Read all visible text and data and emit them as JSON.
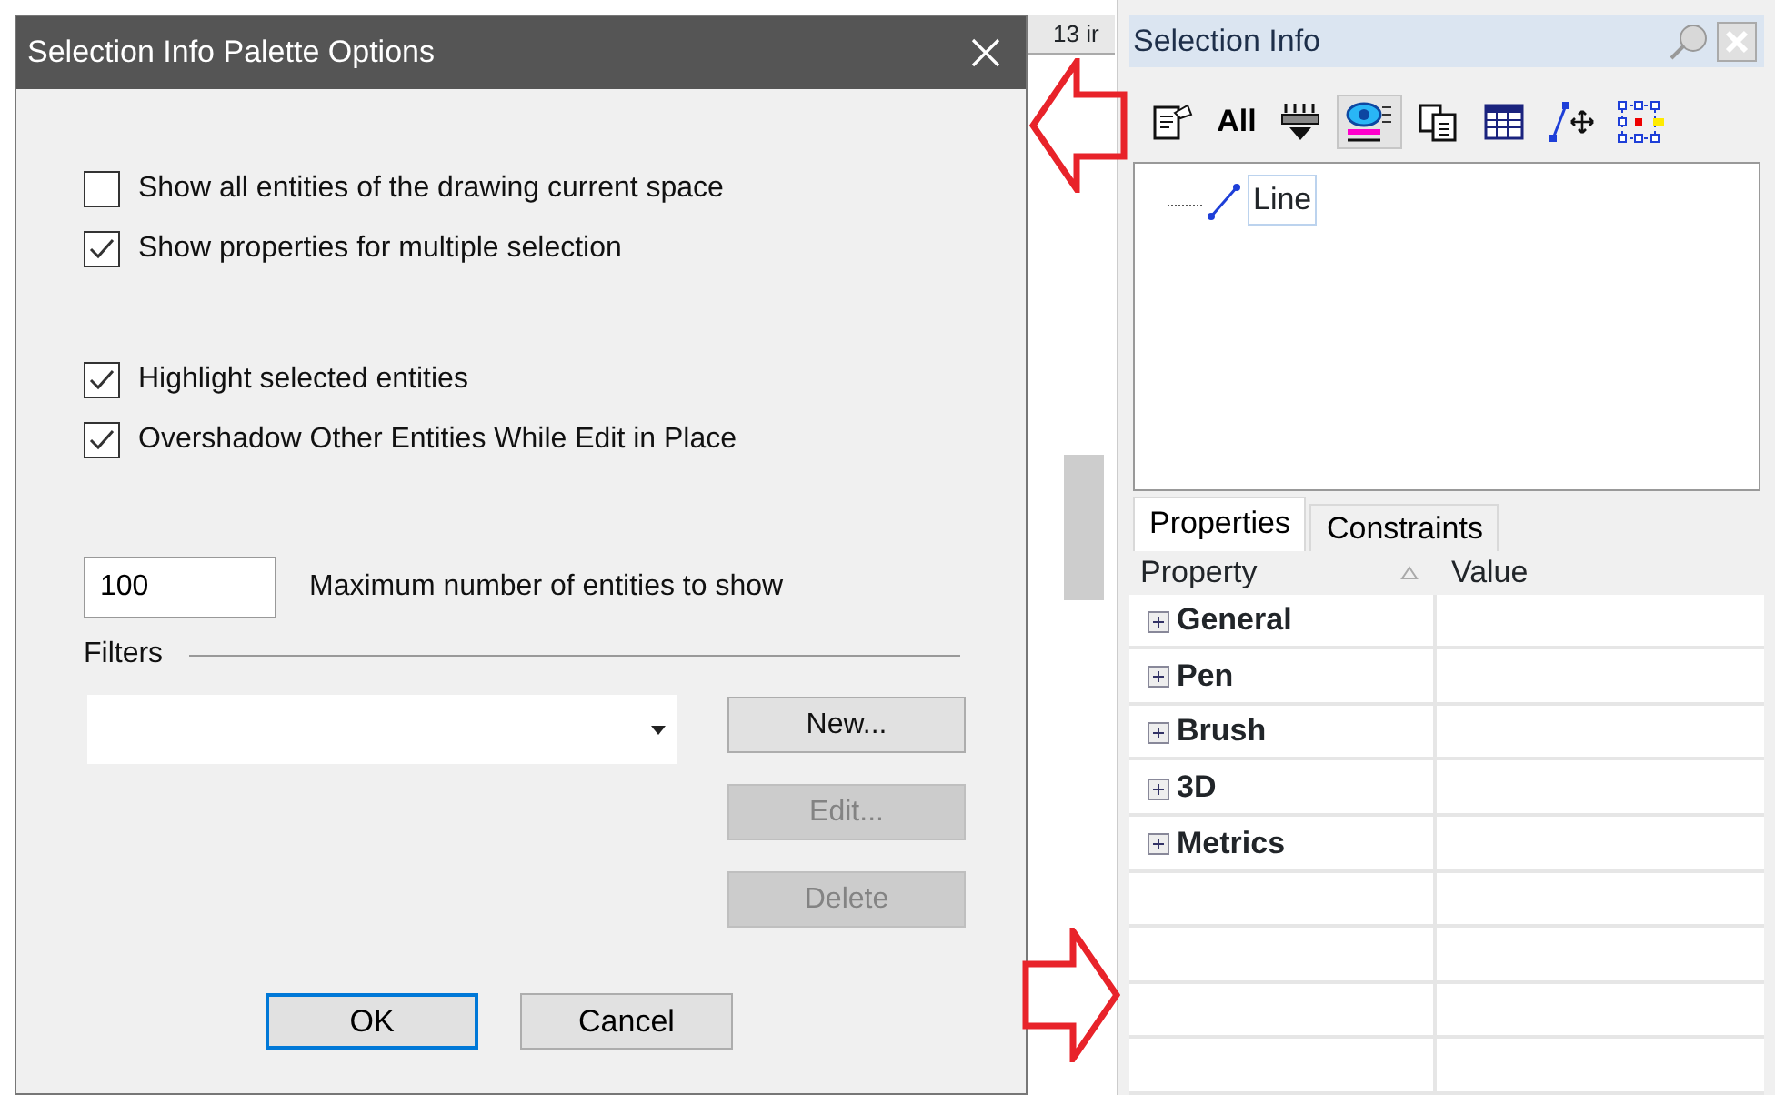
{
  "drawing": {
    "ruler_label": "13 ir"
  },
  "dialog": {
    "title": "Selection Info Palette Options",
    "options": [
      {
        "label": "Show all entities of the drawing current space",
        "checked": false
      },
      {
        "label": "Show properties for multiple selection",
        "checked": true
      },
      {
        "label": "Highlight selected entities",
        "checked": true
      },
      {
        "label": "Overshadow Other Entities While Edit in Place",
        "checked": true
      }
    ],
    "max_entities": {
      "value": "100",
      "label": "Maximum number of entities to show"
    },
    "filters": {
      "label": "Filters",
      "buttons": [
        {
          "label": "New...",
          "disabled": false
        },
        {
          "label": "Edit...",
          "disabled": true
        },
        {
          "label": "Delete",
          "disabled": true
        }
      ]
    },
    "buttons": [
      {
        "label": "OK",
        "default": true
      },
      {
        "label": "Cancel",
        "default": false
      }
    ]
  },
  "panel": {
    "title": "Selection Info",
    "toolbar": [
      {
        "kind": "icon",
        "pressed": false
      },
      {
        "kind": "text",
        "label": "All",
        "pressed": false
      },
      {
        "kind": "icon",
        "pressed": false
      },
      {
        "kind": "icon",
        "pressed": true
      },
      {
        "kind": "icon",
        "pressed": false
      },
      {
        "kind": "icon",
        "pressed": false
      },
      {
        "kind": "icon",
        "pressed": false
      },
      {
        "kind": "icon",
        "pressed": false
      }
    ],
    "tree": [
      {
        "label": "Line",
        "selected": true
      }
    ],
    "tabs": [
      {
        "label": "Properties",
        "selected": true
      },
      {
        "label": "Constraints",
        "selected": false
      }
    ],
    "columns": [
      "Property",
      "Value"
    ],
    "rows": [
      {
        "label": "General",
        "expanded": false
      },
      {
        "label": "Pen",
        "expanded": false
      },
      {
        "label": "Brush",
        "expanded": false
      },
      {
        "label": "3D",
        "expanded": false
      },
      {
        "label": "Metrics",
        "expanded": false
      }
    ]
  }
}
